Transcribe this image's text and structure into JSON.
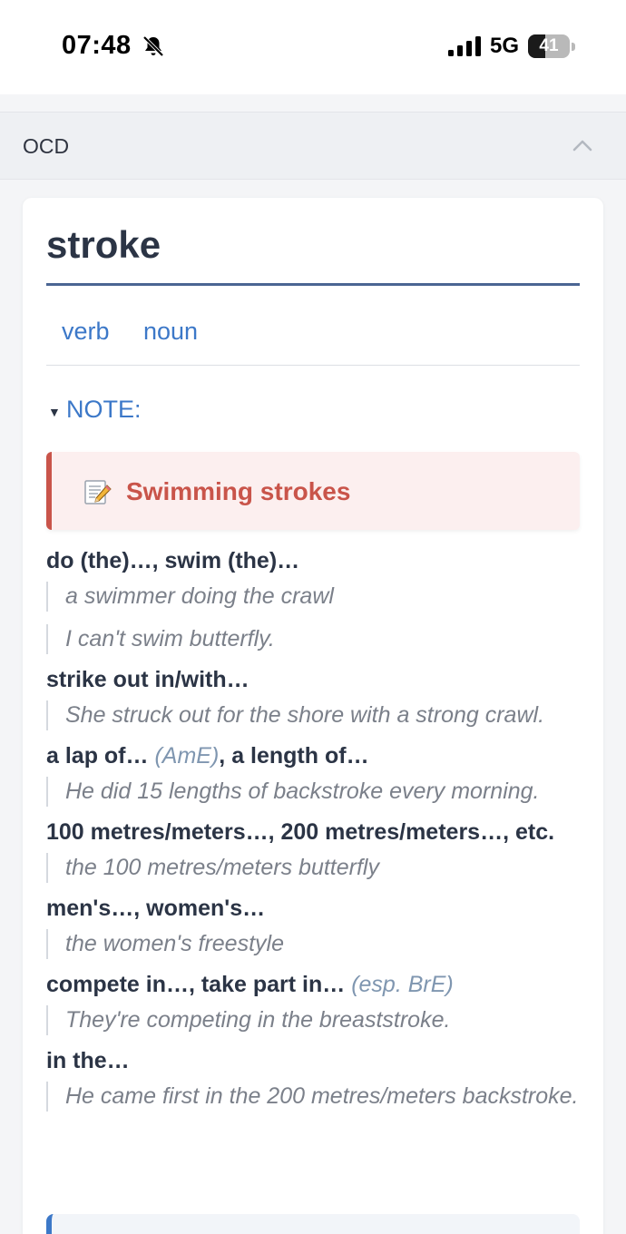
{
  "status_bar": {
    "time": "07:48",
    "network": "5G",
    "battery": "41",
    "battery_level": 0.41
  },
  "section": {
    "title": "OCD"
  },
  "entry": {
    "headword": "stroke",
    "pos_tabs": [
      "verb",
      "noun"
    ],
    "note_label": "NOTE:",
    "note_title": "Swimming strokes"
  },
  "collocations": [
    {
      "lead": "do (the)…, swim (the)…",
      "register": "",
      "tail": "",
      "examples": [
        "a swimmer doing the crawl",
        "I can't swim butterfly."
      ]
    },
    {
      "lead": "strike out in/with…",
      "register": "",
      "tail": "",
      "examples": [
        "She struck out for the shore with a strong crawl."
      ]
    },
    {
      "lead": "a lap of… ",
      "register": "(AmE)",
      "tail": ", a length of…",
      "examples": [
        "He did 15 lengths of backstroke every morning."
      ]
    },
    {
      "lead": "100 metres/meters…, 200 metres/meters…, etc.",
      "register": "",
      "tail": "",
      "examples": [
        "the 100 metres/meters butterfly"
      ]
    },
    {
      "lead": "men's…, women's…",
      "register": "",
      "tail": "",
      "examples": [
        "the women's freestyle"
      ]
    },
    {
      "lead": "compete in…, take part in… ",
      "register": "(esp. BrE)",
      "tail": "",
      "examples": [
        "They're competing in the breaststroke."
      ]
    },
    {
      "lead": "in the…",
      "register": "",
      "tail": "",
      "examples": [
        "He came first in the 200 metres/meters backstroke."
      ]
    }
  ],
  "colors": {
    "accent_blue": "#3c78c8",
    "note_red": "#c9544a",
    "headword_rule": "#4b6593"
  }
}
